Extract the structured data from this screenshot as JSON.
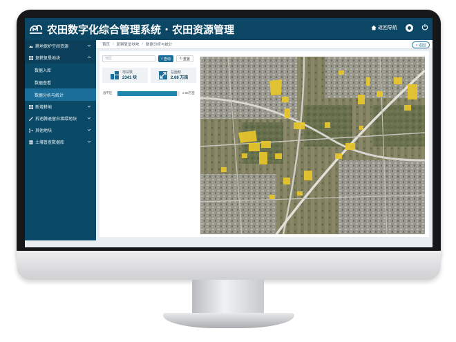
{
  "header": {
    "title": "农田数字化综合管理系统 · 农田资源管理",
    "home_label": "返回导航"
  },
  "sidebar": {
    "items": [
      {
        "label": "耕地保护空间资源",
        "icon": "landscape-icon"
      },
      {
        "label": "复耕复垦地块",
        "icon": "grid-icon"
      },
      {
        "label": "新增耕地",
        "icon": "grid-icon"
      },
      {
        "label": "拆违腾退留白增绿地块",
        "icon": "paint-icon"
      },
      {
        "label": "其他地块",
        "icon": "branch-icon"
      },
      {
        "label": "土壤普查数据库",
        "icon": "database-icon"
      }
    ],
    "subitems": [
      "数据入库",
      "数据查看",
      "数据分析与统计"
    ]
  },
  "breadcrumb": {
    "items": [
      "首页",
      "复耕复垦地块",
      "数据分析与统计"
    ],
    "separator": "/",
    "back_label": "< 返回"
  },
  "search": {
    "placeholder": "地区",
    "query_label": "查询",
    "reset_label": "重置"
  },
  "stats": {
    "plots": {
      "label": "地块数",
      "value": "2341 块"
    },
    "area": {
      "label": "总面积",
      "value": "2.68 万亩"
    }
  },
  "bar": {
    "label": "昌平区",
    "value_text": "2.68万亩",
    "fill_fraction": 0.95
  },
  "colors": {
    "topbar": "#0b4764",
    "sidebar": "#0a4a67",
    "active": "#1b6e99",
    "bar": "#1f86ad",
    "highlight": "#e8c62c"
  }
}
